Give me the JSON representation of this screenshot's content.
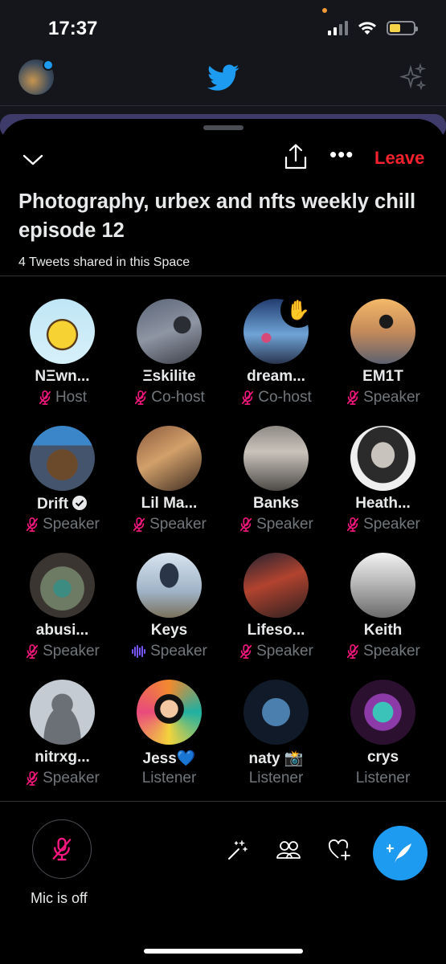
{
  "status": {
    "time": "17:37"
  },
  "space": {
    "leave_label": "Leave",
    "title": "Photography, urbex and nfts weekly chill episode 12",
    "tweets_shared": "4 Tweets shared in this Space"
  },
  "participants": [
    {
      "name": "NΞwn...",
      "role": "Host",
      "mic": "off",
      "avatar": "avatar-cartoon"
    },
    {
      "name": "Ξskilite",
      "role": "Co-host",
      "mic": "off",
      "avatar": "avatar-night-city"
    },
    {
      "name": "dream...",
      "role": "Co-host",
      "mic": "off",
      "avatar": "avatar-rooftop",
      "hand": "✋"
    },
    {
      "name": "EM1T",
      "role": "Speaker",
      "mic": "off",
      "avatar": "avatar-sunset-city"
    },
    {
      "name": "Drift",
      "role": "Speaker",
      "mic": "off",
      "avatar": "avatar-pixel",
      "verified": true
    },
    {
      "name": "Lil Ma...",
      "role": "Speaker",
      "mic": "off",
      "avatar": "avatar-canyon"
    },
    {
      "name": "Banks",
      "role": "Speaker",
      "mic": "off",
      "avatar": "avatar-rooftop-edge"
    },
    {
      "name": "Heath...",
      "role": "Speaker",
      "mic": "off",
      "avatar": "avatar-portrait-bw"
    },
    {
      "name": "abusi...",
      "role": "Speaker",
      "mic": "off",
      "avatar": "avatar-street-down"
    },
    {
      "name": "Keys",
      "role": "Speaker",
      "mic": "speaking",
      "avatar": "avatar-climber"
    },
    {
      "name": "Lifeso...",
      "role": "Speaker",
      "mic": "off",
      "avatar": "avatar-bridge-night"
    },
    {
      "name": "Keith",
      "role": "Speaker",
      "mic": "off",
      "avatar": "avatar-city-bw"
    },
    {
      "name": "nitrxg...",
      "role": "Speaker",
      "mic": "off",
      "avatar": "avatar-default"
    },
    {
      "name": "Jess💙",
      "role": "Listener",
      "mic": "none",
      "avatar": "avatar-illustration"
    },
    {
      "name": "naty 📸",
      "role": "Listener",
      "mic": "none",
      "avatar": "avatar-blue-portrait"
    },
    {
      "name": "crys",
      "role": "Listener",
      "mic": "none",
      "avatar": "avatar-creature"
    }
  ],
  "bottom": {
    "mic_label": "Mic is off"
  },
  "colors": {
    "leave": "#f4212e",
    "mic_off": "#f91880",
    "speaking": "#7856ff",
    "compose": "#1d9bf0"
  }
}
